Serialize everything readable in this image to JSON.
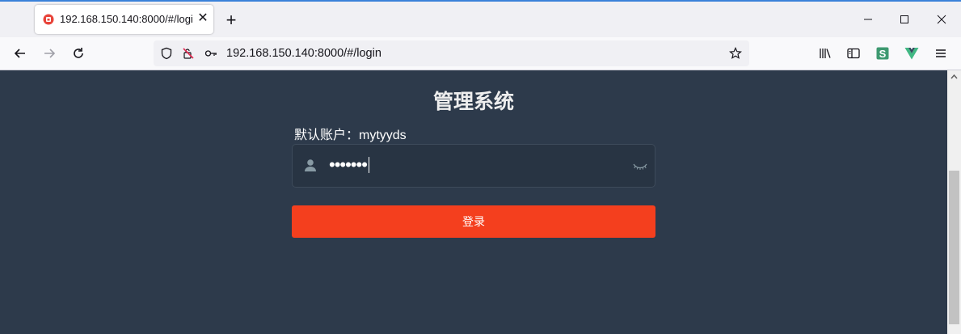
{
  "browser": {
    "tab": {
      "title": "192.168.150.140:8000/#/login",
      "favicon": "app-favicon",
      "close": "close-icon"
    },
    "new_tab": "plus-icon",
    "window_controls": [
      "minimize-icon",
      "maximize-icon",
      "close-icon"
    ],
    "nav": [
      "back-icon",
      "forward-icon",
      "reload-icon"
    ],
    "url": "192.168.150.140:8000/#/login",
    "url_icons": [
      "shield-icon",
      "blocked-permission-icon",
      "key-icon",
      "bookmark-star-icon"
    ],
    "toolbar_icons": [
      "library-icon",
      "sidebar-icon",
      "extension-s-icon",
      "vue-devtools-icon",
      "menu-icon"
    ]
  },
  "login": {
    "title": "管理系统",
    "hint": "默认账户：mytyyds",
    "password_value": "•••••••",
    "button_label": "登录"
  },
  "colors": {
    "background": "#2d3a4b",
    "input_background": "#283443",
    "button": "#f43f1e",
    "accent": "#3a82d9"
  }
}
